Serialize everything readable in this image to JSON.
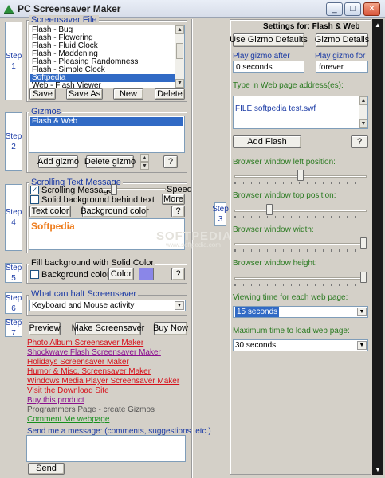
{
  "window": {
    "title": "PC Screensaver Maker",
    "minimize": "_",
    "maximize": "□",
    "close": "✕"
  },
  "steps": {
    "s1": "Step 1",
    "s2": "Step 2",
    "s3": "Step 3",
    "s4": "Step 4",
    "s5": "Step 5",
    "s6": "Step 6",
    "s7": "Step 7"
  },
  "screensaver_file": {
    "title": "Screensaver File",
    "items": [
      "Flash - Bug",
      "Flash - Flowering",
      "Flash - Fluid Clock",
      "Flash - Maddening",
      "Flash - Pleasing Randomness",
      "Flash - Simple Clock",
      "Softpedia",
      "Web - Flash Viewer"
    ],
    "selected": "Softpedia",
    "buttons": {
      "save": "Save",
      "save_as": "Save As",
      "new": "New",
      "delete": "Delete"
    }
  },
  "gizmos": {
    "title": "Gizmos",
    "items": [
      "Flash & Web"
    ],
    "buttons": {
      "add": "Add gizmo",
      "delete": "Delete gizmo",
      "help": "?"
    }
  },
  "scrolling_text": {
    "title": "Scrolling Text Message",
    "scrolling_label": "Scrolling Message",
    "solid_bg_label": "Solid background behind text",
    "speed_label": "Speed",
    "more": "More",
    "text_color": "Text color",
    "bg_color": "Background color",
    "help": "?",
    "preview_text": "Softpedia",
    "scrolling_checked": "✓",
    "speed_level": 0.15
  },
  "fill_bg": {
    "title": "Fill background with Solid Color",
    "bg_color_label": "Background color",
    "color_btn": "Color",
    "help": "?",
    "swatch": "#8a86e8"
  },
  "halt": {
    "title": "What can halt Screensaver",
    "value": "Keyboard and Mouse activity"
  },
  "actions": {
    "preview": "Preview",
    "make": "Make Screensaver",
    "buy": "Buy Now"
  },
  "links": [
    {
      "text": "Photo Album Screensaver Maker",
      "color": "#d6101a"
    },
    {
      "text": "Shockwave Flash Screensaver Maker",
      "color": "#8a0f8f"
    },
    {
      "text": "Holidays Screensaver Maker",
      "color": "#d6101a"
    },
    {
      "text": "Humor & Misc. Screensaver Maker",
      "color": "#d6101a"
    },
    {
      "text": "Windows Media Player Screensaver Maker",
      "color": "#d6101a"
    },
    {
      "text": "Visit the Download Site",
      "color": "#d6101a"
    },
    {
      "text": "Buy this product",
      "color": "#8a0f8f"
    },
    {
      "text": "Programmers Page - create Gizmos",
      "color": "#555555"
    },
    {
      "text": "Comment Me webpage",
      "color": "#168f1c"
    }
  ],
  "message": {
    "label": "Send me a message: (comments, suggestions, etc.)",
    "send": "Send"
  },
  "settings": {
    "title": "Settings for: Flash & Web",
    "use_defaults": "Use Gizmo Defaults",
    "gizmo_details": "Gizmo Details",
    "play_after_label": "Play gizmo after",
    "play_after_value": "0 seconds",
    "play_for_label": "Play gizmo for",
    "play_for_value": "forever",
    "address_label": "Type in Web page address(es):",
    "address_value": "FILE:softpedia test.swf",
    "add_flash": "Add Flash",
    "help": "?",
    "left_label": "Browser window left position:",
    "top_label": "Browser window top position:",
    "width_label": "Browser window width:",
    "height_label": "Browser window height:",
    "left_level": 0.5,
    "top_level": 0.25,
    "width_level": 1.0,
    "height_level": 1.0,
    "viewing_label": "Viewing time for each web page:",
    "viewing_value": "15 seconds",
    "max_label": "Maximum time to load web page:",
    "max_value": "30 seconds"
  },
  "watermark": {
    "main": "SOFTPEDIA",
    "sub": "www.softpedia.com"
  }
}
